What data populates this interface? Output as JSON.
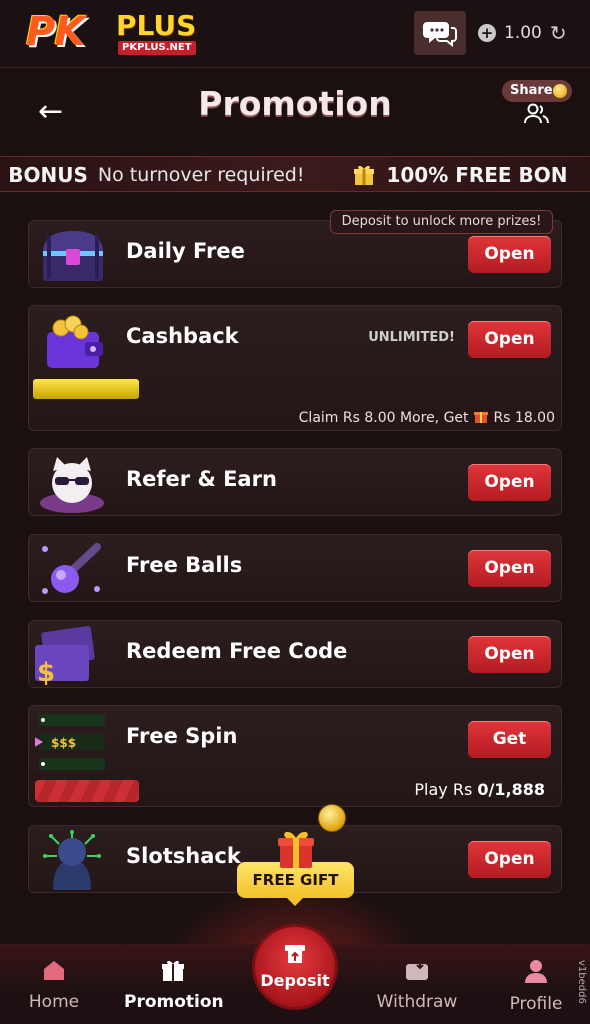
{
  "header": {
    "logo_text_pk": "PK",
    "logo_text_plus": "PLUS",
    "logo_url": "PKPLUS.NET",
    "chat_icon": "chat-bubbles-icon",
    "balance": "1.00"
  },
  "page": {
    "title": "Promotion",
    "share_label": "Share"
  },
  "ticker": {
    "part1": "EE BONUS",
    "part2": "No turnover required!",
    "part3": "100% FREE BON"
  },
  "promos": {
    "deposit_note": "Deposit to unlock more prizes!",
    "daily_free": {
      "title": "Daily Free",
      "button": "Open"
    },
    "cashback": {
      "title": "Cashback",
      "badge": "UNLIMITED!",
      "button": "Open",
      "claim_prefix": "Claim Rs 8.00 More, Get",
      "claim_suffix": "Rs 18.00",
      "progress": 0.2
    },
    "refer": {
      "title": "Refer & Earn",
      "button": "Open"
    },
    "free_balls": {
      "title": "Free Balls",
      "button": "Open"
    },
    "redeem": {
      "title": "Redeem Free Code",
      "button": "Open"
    },
    "free_spin": {
      "title": "Free Spin",
      "button": "Get",
      "play_prefix": "Play Rs",
      "play_value": "0/1,888",
      "tag": "$$$"
    },
    "slotshack": {
      "title": "Slotshack",
      "button": "Open"
    }
  },
  "free_gift": "FREE GIFT",
  "nav": {
    "home": "Home",
    "promotion": "Promotion",
    "deposit": "Deposit",
    "withdraw": "Withdraw",
    "profile": "Profile"
  },
  "version": "v1bedd6"
}
